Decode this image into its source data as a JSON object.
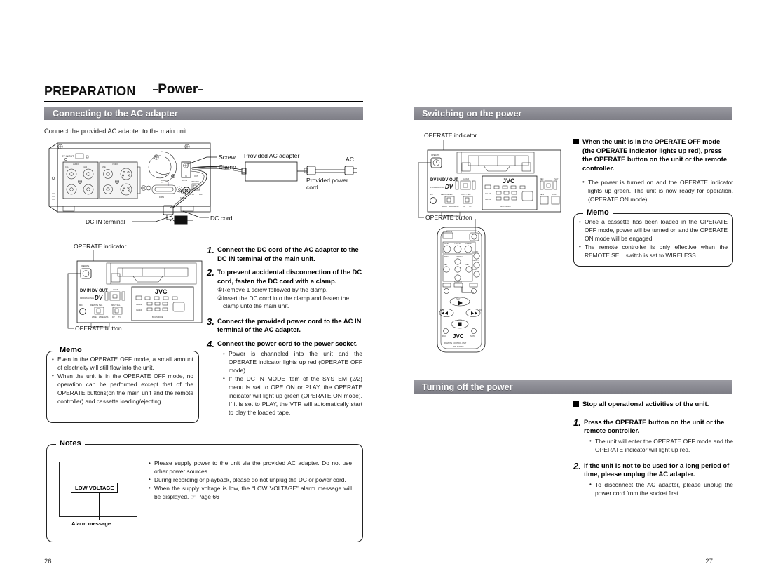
{
  "document": {
    "chapter": "PREPARATION",
    "chapter_sub_prefix": "–",
    "chapter_sub": "Power",
    "chapter_sub_suffix": "–",
    "left_page_number": "26",
    "right_page_number": "27"
  },
  "left": {
    "section_title": "Connecting to the AC adapter",
    "intro": "Connect the provided AC adapter to the main unit.",
    "diagram_rear": {
      "labels": {
        "screw": "Screw",
        "clamp": "Clamp",
        "ac_adapter": "Provided AC adapter",
        "ac": "AC",
        "power_cord_line1": "Provided power",
        "power_cord_line2": "cord",
        "dc_in_terminal": "DC IN terminal",
        "dc_cord": "DC cord",
        "dv_in_out": "DV IN/OUT",
        "audio": "AUDIO",
        "video": "VIDEO",
        "ch1": "CH-1",
        "ch2": "CH-2",
        "line": "LINE",
        "remote": "REMOTE",
        "d9pin": "D-PIN",
        "serial": "SERIAL",
        "ntsc_pal": "NTSC/PAL",
        "ntsc": "NTSC",
        "pal": "PAL",
        "dc_in": "DC IN",
        "in": "IN",
        "out": "OUT"
      }
    },
    "diagram_front": {
      "labels": {
        "operate_indicator": "OPERATE indicator",
        "operate_button": "OPERATE button",
        "operate": "OPERATE",
        "dv_in_dv_out": "DV IN      DV OUT",
        "professional": "PROFESSIONAL",
        "dv": "DV",
        "audio_dub": "A.DUB",
        "mic": "MIC",
        "remote_sel": "REMOTE SEL.",
        "input_sel": "INPUT SEL.",
        "wire": "WIRE",
        "wireless": "WIRELESS",
        "tc": "TC",
        "jvc": "JVC",
        "model": "BR-DV3000E",
        "rec": "REC",
        "play": "PLAY",
        "ff": "FF",
        "rew": "REW",
        "stop": "STOP",
        "ch12": "CH-1/2",
        "ch34": "CH-3/4"
      }
    },
    "steps": [
      {
        "num": "1.",
        "title": "Connect the DC cord of the AC adapter to the DC IN terminal of the main unit.",
        "subs": [],
        "notes": []
      },
      {
        "num": "2.",
        "title": "To prevent accidental disconnection of the DC cord, fasten the DC cord with a clamp.",
        "subs": [
          "①Remove 1 screw followed by the clamp.",
          "②Insert the DC cord into the clamp and fasten the clamp unto the main unit."
        ],
        "notes": []
      },
      {
        "num": "3.",
        "title": "Connect the provided power cord to the AC IN terminal of the AC adapter.",
        "subs": [],
        "notes": []
      },
      {
        "num": "4.",
        "title": "Connect the power cord to the power socket.",
        "subs": [],
        "notes": [
          "Power is channeled into the unit and the OPERATE indicator lights up red (OPERATE OFF mode).",
          "If the DC IN MODE item of the SYSTEM (2/2) menu is set to OPE ON or PLAY, the OPERATE indicator will light up green (OPERATE ON mode). If it is set to PLAY, the VTR will automatically start to play the loaded tape."
        ]
      }
    ],
    "memo": {
      "legend": "Memo",
      "items": [
        "Even in the OPERATE OFF mode, a small amount of electricity will still flow into the unit.",
        "When the unit is in the OPERATE OFF mode, no operation can be performed except that of the OPERATE buttons(on the main unit and the remote controller) and cassette loading/ejecting."
      ]
    },
    "notes": {
      "legend": "Notes",
      "items": [
        "Please supply power to the unit via the provided AC adapter. Do not use other power sources.",
        "During recording or playback, please do not unplug the DC or power cord.",
        "When the supply voltage is low, the “LOW VOLTAGE” alarm message will be displayed. ☞ Page 66"
      ],
      "monitor": {
        "alarm_text": "LOW VOLTAGE",
        "caption": "Alarm message"
      }
    }
  },
  "right": {
    "section_on_title": "Switching on the power",
    "section_off_title": "Turning off the power",
    "diagram_front": {
      "labels": {
        "operate_indicator": "OPERATE indicator",
        "operate_button": "OPERATE button",
        "jvc": "JVC",
        "model": "BR-DV3000E"
      }
    },
    "remote": {
      "labels": {
        "jvc": "JVC",
        "caption1": "REMOTE CONTROL UNIT",
        "caption2": "RM-DV3000"
      }
    },
    "switch_on": {
      "heading": "When the unit is in the OPERATE OFF mode (the OPERATE indicator lights up red), press the OPERATE button on the unit or the remote controller.",
      "notes": [
        "The power is turned on and the OPERATE indicator lights up green.  The unit is now ready for operation. (OPERATE ON mode)"
      ],
      "memo": {
        "legend": "Memo",
        "items": [
          "Once a cassette has been loaded in the OPERATE OFF mode, power will be turned on and the OPERATE ON mode will be engaged.",
          "The remote controller is only effective when the REMOTE SEL. switch is set to WIRELESS."
        ]
      }
    },
    "switch_off": {
      "heading": "Stop all operational activities of the unit.",
      "steps": [
        {
          "num": "1.",
          "title": "Press the OPERATE button on the unit or the remote controller.",
          "notes": [
            "The unit will enter the OPERATE OFF mode and the OPERATE indicator will light up red."
          ]
        },
        {
          "num": "2.",
          "title": "If the unit is not to be used for a long period of time, please unplug the AC adapter.",
          "notes": [
            "To disconnect the AC adapter, please unplug the power cord from the socket first."
          ]
        }
      ]
    }
  },
  "colors": {
    "section_bar": "#8a8a92",
    "text": "#1a1a1a",
    "rule": "#000000"
  }
}
